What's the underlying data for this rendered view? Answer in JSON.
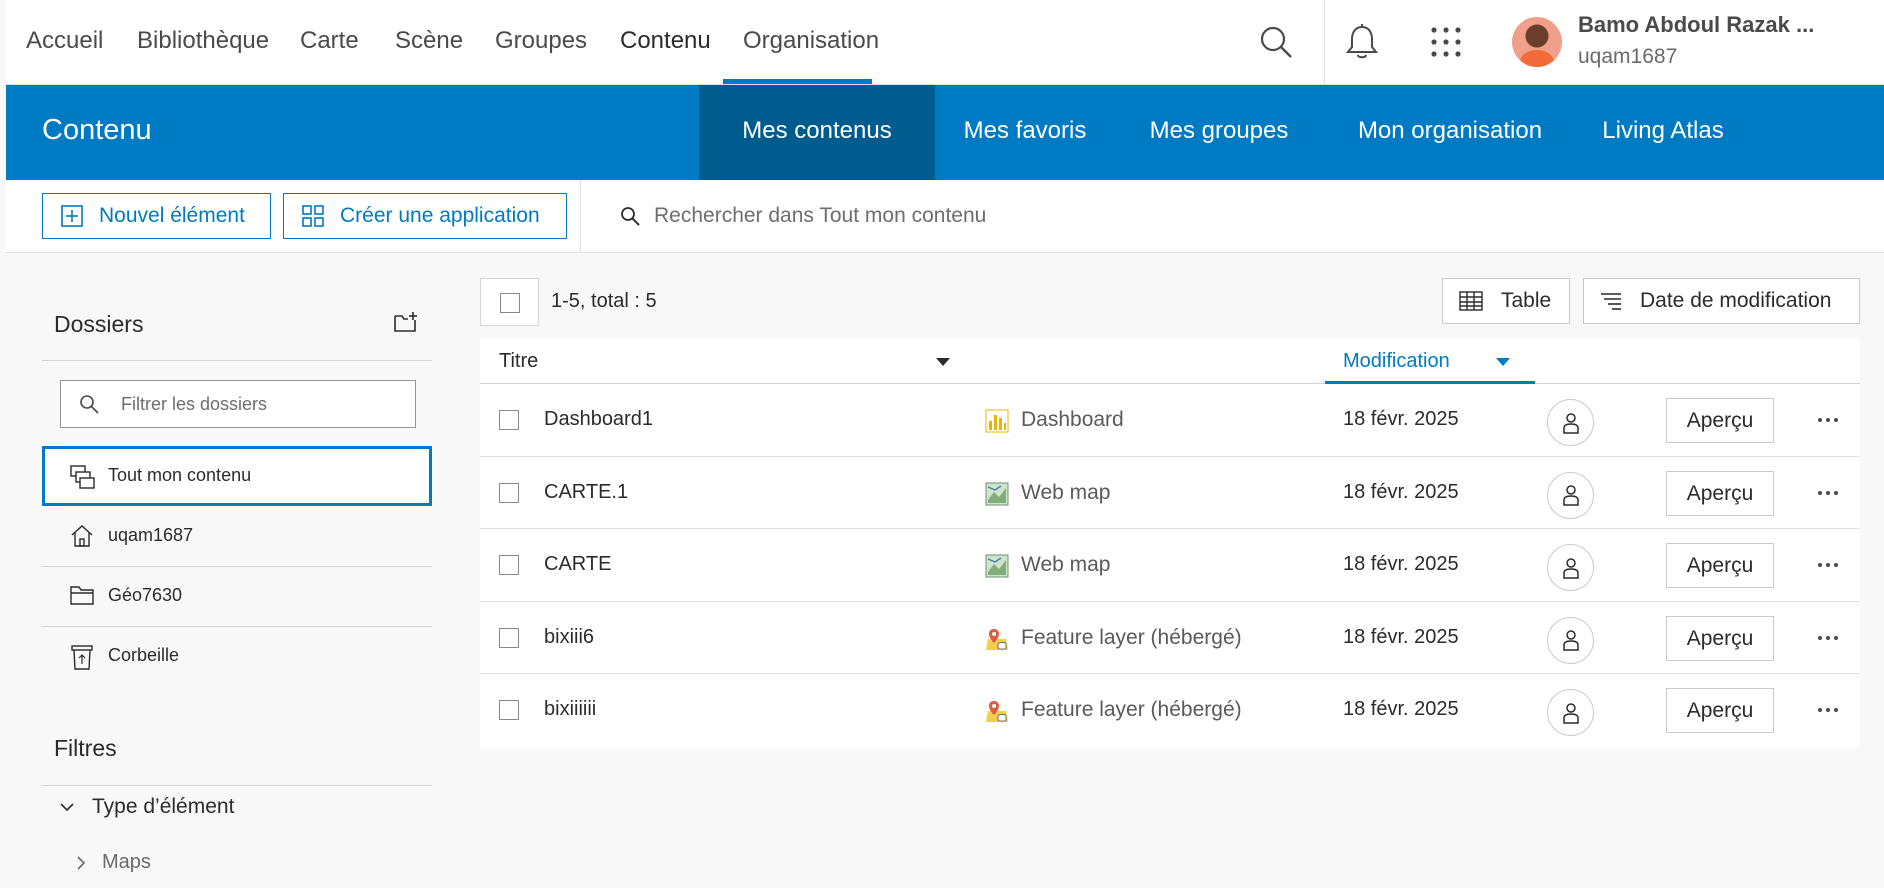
{
  "topnav": {
    "items": [
      "Accueil",
      "Bibliothèque",
      "Carte",
      "Scène",
      "Groupes",
      "Contenu",
      "Organisation"
    ],
    "active": "Contenu",
    "user": {
      "name": "Bamo Abdoul Razak ...",
      "login": "uqam1687"
    },
    "icons": [
      "search-icon",
      "bell-icon",
      "app-launcher-icon"
    ]
  },
  "header": {
    "title": "Contenu",
    "tabs": [
      "Mes contenus",
      "Mes favoris",
      "Mes groupes",
      "Mon organisation",
      "Living Atlas"
    ],
    "active_tab": "Mes contenus",
    "accent_color": "#007ac2",
    "active_tab_color": "#005b8f"
  },
  "toolbar": {
    "new_item_label": "Nouvel élément",
    "create_app_label": "Créer une application",
    "search_placeholder": "Rechercher dans Tout mon contenu"
  },
  "sidebar": {
    "folders_title": "Dossiers",
    "filter_placeholder": "Filtrer les dossiers",
    "folders": [
      {
        "label": "Tout mon contenu",
        "icon": "all-content-icon",
        "selected": true
      },
      {
        "label": "uqam1687",
        "icon": "home-icon",
        "selected": false
      },
      {
        "label": "Géo7630",
        "icon": "folder-icon",
        "selected": false
      },
      {
        "label": "Corbeille",
        "icon": "recycle-bin-icon",
        "selected": false
      }
    ],
    "filters_title": "Filtres",
    "filter_group": "Type d’élément",
    "filter_sub": "Maps"
  },
  "content": {
    "count_text": "1-5, total : 5",
    "view_label": "Table",
    "sort_label": "Date de modification",
    "columns": {
      "title": "Titre",
      "modified": "Modification"
    },
    "preview_label": "Aperçu",
    "rows": [
      {
        "title": "Dashboard1",
        "type": "Dashboard",
        "icon": "dashboard-icon",
        "date": "18 févr. 2025"
      },
      {
        "title": "CARTE.1",
        "type": "Web map",
        "icon": "web-map-icon",
        "date": "18 févr. 2025"
      },
      {
        "title": "CARTE",
        "type": "Web map",
        "icon": "web-map-icon",
        "date": "18 févr. 2025"
      },
      {
        "title": "bixiii6",
        "type": "Feature layer (hébergé)",
        "icon": "feature-layer-icon",
        "date": "18 févr. 2025"
      },
      {
        "title": "bixiiiiii",
        "type": "Feature layer (hébergé)",
        "icon": "feature-layer-icon",
        "date": "18 févr. 2025"
      }
    ]
  }
}
